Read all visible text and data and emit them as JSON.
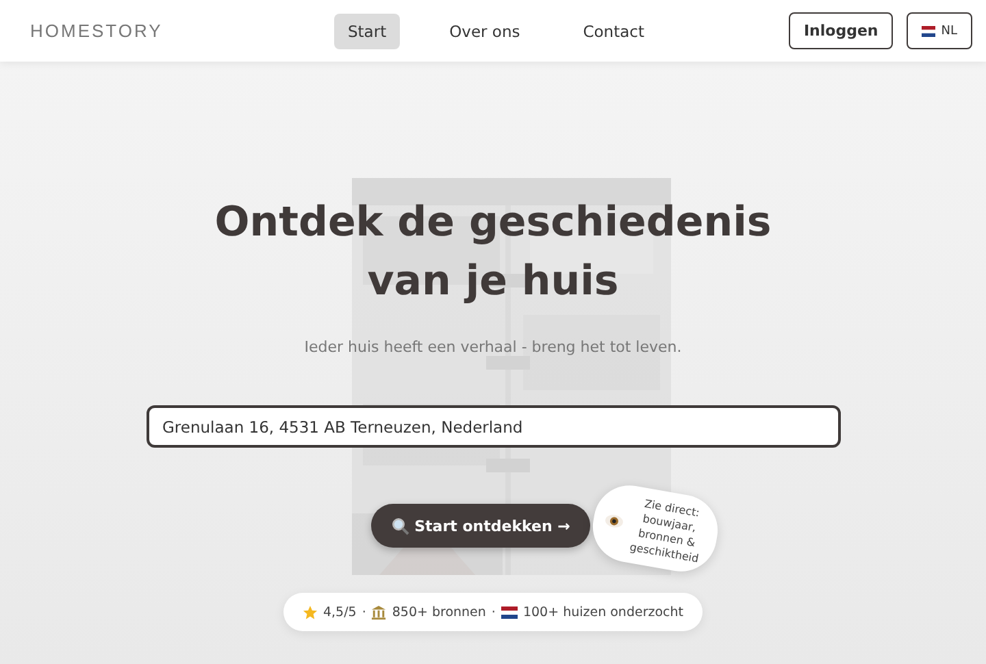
{
  "brand": "HOMESTORY",
  "nav": [
    {
      "label": "Start",
      "selected": true
    },
    {
      "label": "Over ons",
      "selected": false
    },
    {
      "label": "Contact",
      "selected": false
    }
  ],
  "login_button": "Inloggen",
  "language_button": "NL",
  "hero": {
    "title_lines": [
      "Ontdek de geschiedenis",
      "van je huis"
    ],
    "subtitle": "Ieder huis heeft een verhaal - breng het tot leven.",
    "address_field": {
      "value": "Grenulaan 16, 4531 AB Terneuzen, Nederland"
    },
    "search_button": "Start ontdekken →",
    "callout": "Zie direct: bouwjaar, bronnen & geschiktheid",
    "separator": "·",
    "stats": [
      {
        "kind": "star",
        "text": "4,5/5"
      },
      {
        "kind": "museum",
        "text": "850+ bronnen"
      },
      {
        "kind": "flag",
        "text": "100+ huizen onderzocht"
      }
    ]
  }
}
